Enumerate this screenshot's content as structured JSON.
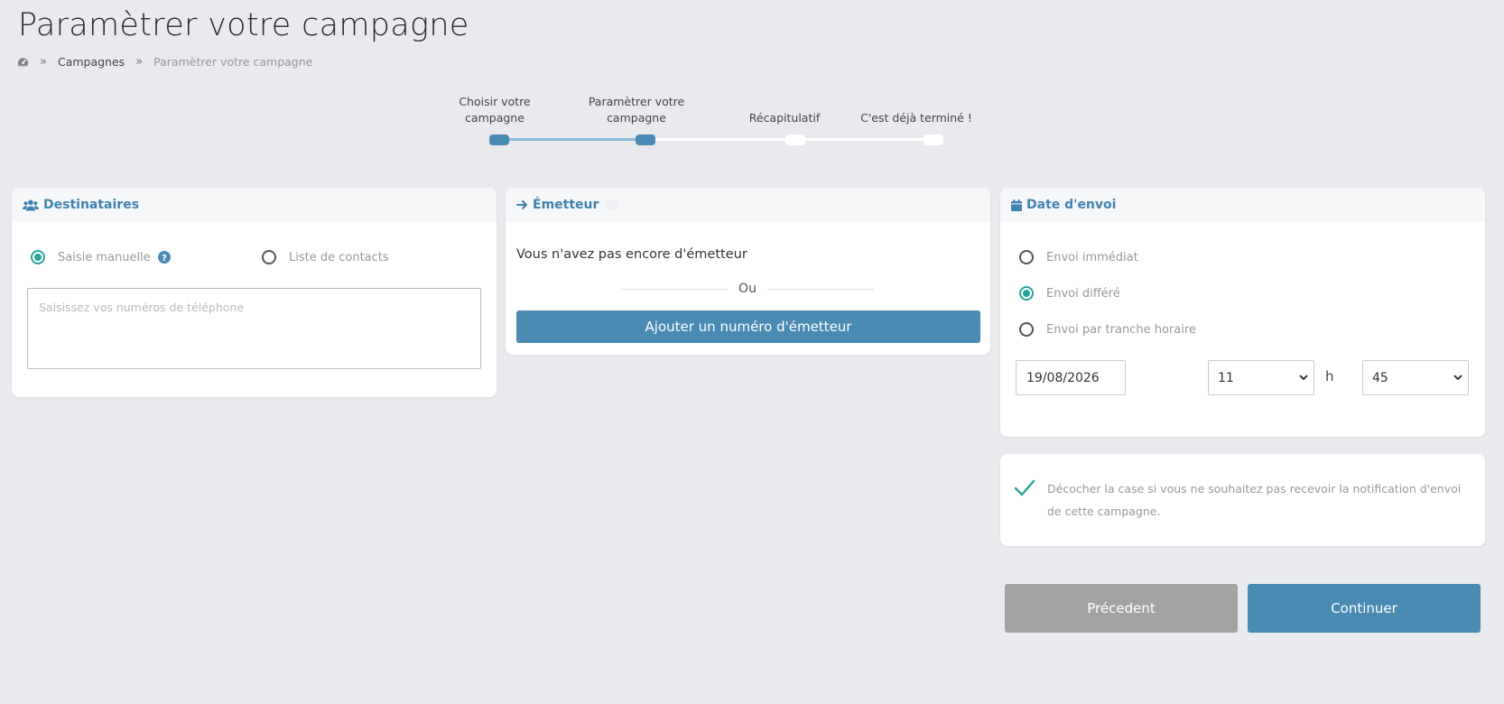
{
  "page": {
    "title": "Paramètrer votre campagne"
  },
  "breadcrumb": {
    "sep": "»",
    "items": [
      "Campagnes",
      "Paramètrer votre campagne"
    ]
  },
  "stepper": {
    "steps": [
      {
        "label": "Choisir votre campagne",
        "active": true
      },
      {
        "label": "Paramètrer votre campagne",
        "active": true
      },
      {
        "label": "Récapitulatif",
        "active": false
      },
      {
        "label": "C'est déjà terminé !",
        "active": false
      }
    ],
    "active_color": "#4a8ab3"
  },
  "recipients": {
    "title": "Destinataires",
    "manual_label": "Saisie manuelle",
    "contacts_label": "Liste de contacts",
    "selected": "manual",
    "phones_placeholder": "Saisissez vos numéros de téléphone",
    "phones_value": ""
  },
  "emitter": {
    "title": "Émetteur",
    "no_emitter_text": "Vous n'avez pas encore d'émetteur",
    "or_label": "Ou",
    "add_button": "Ajouter un numéro d'émetteur"
  },
  "send_date": {
    "title": "Date d'envoi",
    "options": [
      "Envoi immédiat",
      "Envoi différé",
      "Envoi par tranche horaire"
    ],
    "selected_index": 1,
    "date_value": "19/08/2026",
    "hour_value": "11",
    "hour_sep": "h",
    "minute_value": "45"
  },
  "notification": {
    "checked": true,
    "text": "Décocher la case si vous ne souhaitez pas recevoir la notification d'envoi de cette campagne."
  },
  "actions": {
    "prev_label": "Précedent",
    "next_label": "Continuer"
  },
  "colors": {
    "accent": "#4a8ab3",
    "radio": "#27a49a",
    "background": "#e9eaee"
  }
}
